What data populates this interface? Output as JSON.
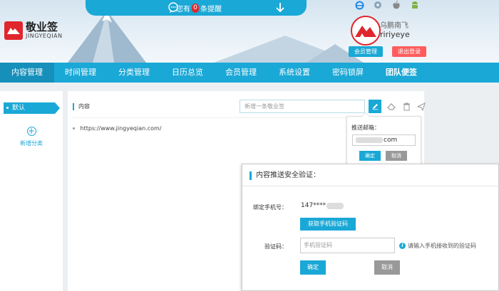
{
  "app": {
    "name_cn": "敬业签",
    "name_en": "JINGYEQIAN"
  },
  "notice": {
    "prefix": "您有",
    "count": "0",
    "suffix": "条提醒"
  },
  "platforms": [
    "ie-icon",
    "mac-icon",
    "apple-icon",
    "android-icon"
  ],
  "user": {
    "nickname": "乌鹏南飞",
    "account": "ririyeye",
    "member_btn": "会员管理",
    "logout_btn": "退出登录"
  },
  "nav": [
    {
      "label": "内容管理"
    },
    {
      "label": "时间管理"
    },
    {
      "label": "分类管理"
    },
    {
      "label": "日历总览"
    },
    {
      "label": "会员管理"
    },
    {
      "label": "系统设置"
    },
    {
      "label": "密码锁屏"
    },
    {
      "label": "团队便签"
    }
  ],
  "sidebar": {
    "default_label": "默认",
    "add_label": "新增分类"
  },
  "main": {
    "content_label": "内容",
    "new_placeholder": "新增一条敬业签",
    "items": [
      {
        "text": "https://www.jingyeqian.com/"
      }
    ]
  },
  "push": {
    "label": "推送邮箱：",
    "email_suffix": "com",
    "ok": "确定",
    "cancel": "取消"
  },
  "verify": {
    "title": "内容推送安全验证：",
    "phone_label": "绑定手机号：",
    "phone_value": "147****",
    "get_code_btn": "获取手机验证码",
    "code_label": "验证码：",
    "code_placeholder": "手机验证码",
    "hint": "请输入手机接收到的验证码",
    "confirm": "确定",
    "cancel": "取消"
  },
  "colors": {
    "primary": "#1aa8d6",
    "nav_active": "#1690bb",
    "brand_red": "#e0262c",
    "logout": "#ff5d5d",
    "gray_btn": "#999999"
  }
}
